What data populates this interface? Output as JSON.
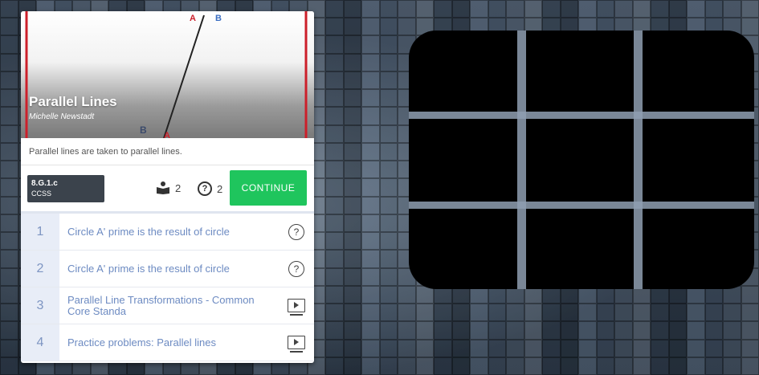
{
  "lesson": {
    "title": "Parallel Lines",
    "author": "Michelle Newstadt",
    "description": "Parallel lines are taken to parallel lines.",
    "thumb_labels": {
      "top": "A",
      "top2": "B",
      "bottom_b": "B",
      "bottom_a": "A"
    }
  },
  "standard": {
    "code": "8.G.1.c",
    "set": "CCSS"
  },
  "counts": {
    "videos": "2",
    "questions": "2",
    "video_icon": "book-reader-icon",
    "question_icon": "question-circle-icon",
    "question_glyph": "?"
  },
  "continue_label": "CONTINUE",
  "items": [
    {
      "num": "1",
      "title": "Circle A' prime is the result of circle",
      "type": "question",
      "glyph": "?"
    },
    {
      "num": "2",
      "title": "Circle A' prime is the result of circle",
      "type": "question",
      "glyph": "?"
    },
    {
      "num": "3",
      "title": "Parallel Line Transformations - Common Core Standa",
      "type": "video"
    },
    {
      "num": "4",
      "title": "Practice problems: Parallel lines",
      "type": "video"
    }
  ],
  "colors": {
    "continue": "#1fc55d",
    "item_text": "#6d8bc2",
    "number_bg": "#e8edf7",
    "panel": "#000000"
  }
}
